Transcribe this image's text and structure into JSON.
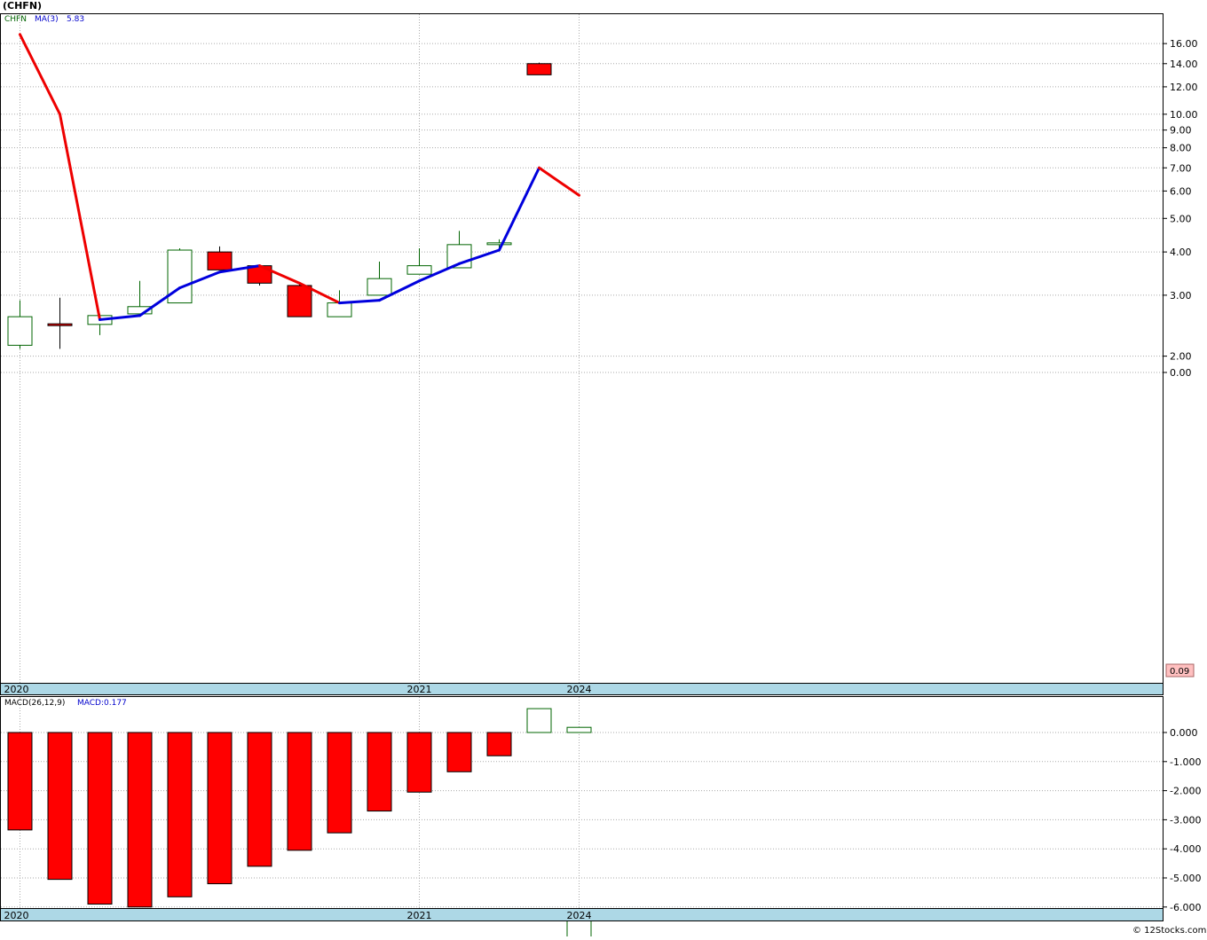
{
  "title": "(CHFN)",
  "legend": {
    "ticker": "CHFN",
    "ma_label": "MA(3)",
    "ma_value": "5.83",
    "macd_label": "MACD(26,12,9)",
    "macd_value": "MACD:0.177"
  },
  "last_price_badge": "0.09",
  "watermark": "© 12Stocks.com",
  "colors": {
    "up": "#006400",
    "down": "#ff0000",
    "ma_rising": "#0000dd",
    "ma_falling": "#ee0000",
    "axis_band": "#add8e6",
    "grid": "#aaaaaa",
    "badge_bg": "#ffc0c0"
  },
  "chart_data": [
    {
      "type": "candlestick",
      "scale": "log",
      "title": "(CHFN)",
      "y_ticks": [
        "16.00",
        "14.00",
        "12.00",
        "10.00",
        "9.00",
        "8.00",
        "7.00",
        "6.00",
        "5.00",
        "4.00",
        "3.00",
        "2.00",
        "0.00"
      ],
      "x_labels": [
        {
          "label": "2020",
          "bar": 0
        },
        {
          "label": "2021",
          "bar": 10
        },
        {
          "label": "2024",
          "bar": 14
        }
      ],
      "candles": [
        {
          "o": 2.15,
          "h": 2.9,
          "l": 2.1,
          "c": 2.6
        },
        {
          "o": 2.48,
          "h": 2.95,
          "l": 2.1,
          "c": 2.45
        },
        {
          "o": 2.47,
          "h": 2.65,
          "l": 2.3,
          "c": 2.62
        },
        {
          "o": 2.65,
          "h": 3.3,
          "l": 2.6,
          "c": 2.78
        },
        {
          "o": 2.85,
          "h": 4.1,
          "l": 2.85,
          "c": 4.05
        },
        {
          "o": 4.0,
          "h": 4.15,
          "l": 3.6,
          "c": 3.55
        },
        {
          "o": 3.65,
          "h": 3.65,
          "l": 3.2,
          "c": 3.25
        },
        {
          "o": 3.2,
          "h": 3.25,
          "l": 2.6,
          "c": 2.6
        },
        {
          "o": 2.6,
          "h": 3.1,
          "l": 2.6,
          "c": 2.85
        },
        {
          "o": 3.0,
          "h": 3.75,
          "l": 3.0,
          "c": 3.35
        },
        {
          "o": 3.45,
          "h": 4.1,
          "l": 3.45,
          "c": 3.65
        },
        {
          "o": 3.6,
          "h": 4.6,
          "l": 3.6,
          "c": 4.2
        },
        {
          "o": 4.25,
          "h": 4.35,
          "l": 4.05,
          "c": 4.25
        },
        {
          "o": 14.0,
          "h": 14.1,
          "l": 13.0,
          "c": 13.0
        },
        {
          "o": 0.035,
          "h": 0.1,
          "l": 0.035,
          "c": 0.09
        }
      ],
      "ma3": [
        17.0,
        10.0,
        2.55,
        2.62,
        3.15,
        3.5,
        3.65,
        3.25,
        2.85,
        2.9,
        3.3,
        3.7,
        4.05,
        7.0,
        5.83
      ]
    },
    {
      "type": "bar",
      "title": "MACD(26,12,9)",
      "y_ticks": [
        "0.000",
        "-1.000",
        "-2.000",
        "-3.000",
        "-4.000",
        "-5.000",
        "-6.000"
      ],
      "ylim": [
        -6.0,
        1.0
      ],
      "x_labels": [
        {
          "label": "2020",
          "bar": 0
        },
        {
          "label": "2021",
          "bar": 10
        },
        {
          "label": "2024",
          "bar": 14
        }
      ],
      "values": [
        -3.35,
        -5.05,
        -5.9,
        -6.0,
        -5.65,
        -5.2,
        -4.6,
        -4.05,
        -3.45,
        -2.7,
        -2.05,
        -1.35,
        -0.8,
        0.82,
        0.177
      ]
    }
  ]
}
